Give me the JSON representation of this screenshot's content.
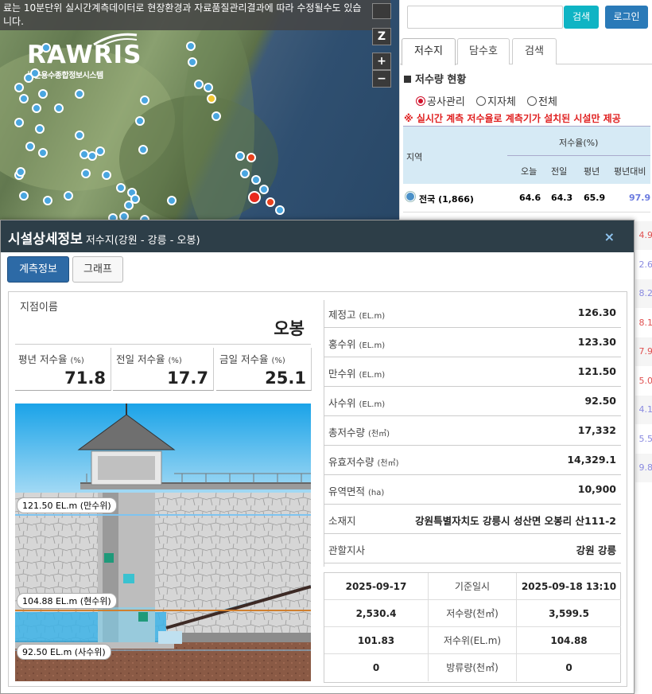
{
  "map": {
    "notice_line1": "료는 10분단위 실시간계측데이터로 현장환경과 자료품질관리결과에 따라 수정될수도 있습",
    "notice_line2": "니다.",
    "logo_brand": "RAWRIS",
    "logo_sub": "농촌용수종합정보시스템",
    "ctrl_z": "Z",
    "ctrl_zoom_in": "+",
    "ctrl_zoom_out": "−"
  },
  "panel": {
    "search_placeholder": "",
    "search_button": "검색",
    "login_button": "로그인",
    "tabs": [
      "저수지",
      "담수호",
      "검색"
    ],
    "section_title": "저수량 현황",
    "radio_options": [
      "공사관리",
      "지자체",
      "전체"
    ],
    "notice": "※ 실시간 계측 저수율로 계측기가 설치된 시설만 제공",
    "table": {
      "col_region": "지역",
      "col_group": "저수율(%)",
      "col_today": "오늘",
      "col_yesterday": "전일",
      "col_normal": "평년",
      "col_vs_normal": "평년대비",
      "first_row": {
        "region": "전국 (1,866)",
        "today": "64.6",
        "yesterday": "64.3",
        "normal": "65.9",
        "vs_normal": "97.9"
      },
      "partial_vs_normal": [
        "4.9",
        "2.6",
        "8.2",
        "8.1",
        "7.9",
        "5.0",
        "4.1",
        "5.5",
        "9.8"
      ]
    }
  },
  "modal": {
    "title": "시설상세정보",
    "subtitle": "저수지(강원 - 강릉 - 오봉)",
    "close_icon": "×",
    "tabs": [
      "계측정보",
      "그래프"
    ],
    "station_label": "지점이름",
    "station_name": "오봉",
    "rates": [
      {
        "label": "평년 저수율",
        "unit": "(%)",
        "value": "71.8"
      },
      {
        "label": "전일 저수율",
        "unit": "(%)",
        "value": "17.7"
      },
      {
        "label": "금일 저수율",
        "unit": "(%)",
        "value": "25.1"
      }
    ],
    "illustration": {
      "full_level": "121.50 EL.m (만수위)",
      "current_level": "104.88 EL.m (현수위)",
      "dead_level": "92.50 EL.m (사수위)"
    },
    "specs": [
      {
        "key": "제정고",
        "unit": "(EL.m)",
        "value": "126.30"
      },
      {
        "key": "홍수위",
        "unit": "(EL.m)",
        "value": "123.30"
      },
      {
        "key": "만수위",
        "unit": "(EL.m)",
        "value": "121.50"
      },
      {
        "key": "사수위",
        "unit": "(EL.m)",
        "value": "92.50"
      },
      {
        "key": "총저수량",
        "unit": "(천㎥)",
        "value": "17,332"
      },
      {
        "key": "유효저수량",
        "unit": "(천㎥)",
        "value": "14,329.1"
      },
      {
        "key": "유역면적",
        "unit": "(ha)",
        "value": "10,900"
      },
      {
        "key": "소재지",
        "unit": "",
        "value": "강원특별자치도 강릉시 성산면 오봉리 산111-2"
      },
      {
        "key": "관할지사",
        "unit": "",
        "value": "강원 강릉"
      }
    ],
    "grid": {
      "rows": [
        [
          "2025-09-17",
          "기준일시",
          "2025-09-18 13:10"
        ],
        [
          "2,530.4",
          "저수량(천㎥)",
          "3,599.5"
        ],
        [
          "101.83",
          "저수위(EL.m)",
          "104.88"
        ],
        [
          "0",
          "방류량(천㎥)",
          "0"
        ]
      ]
    }
  }
}
